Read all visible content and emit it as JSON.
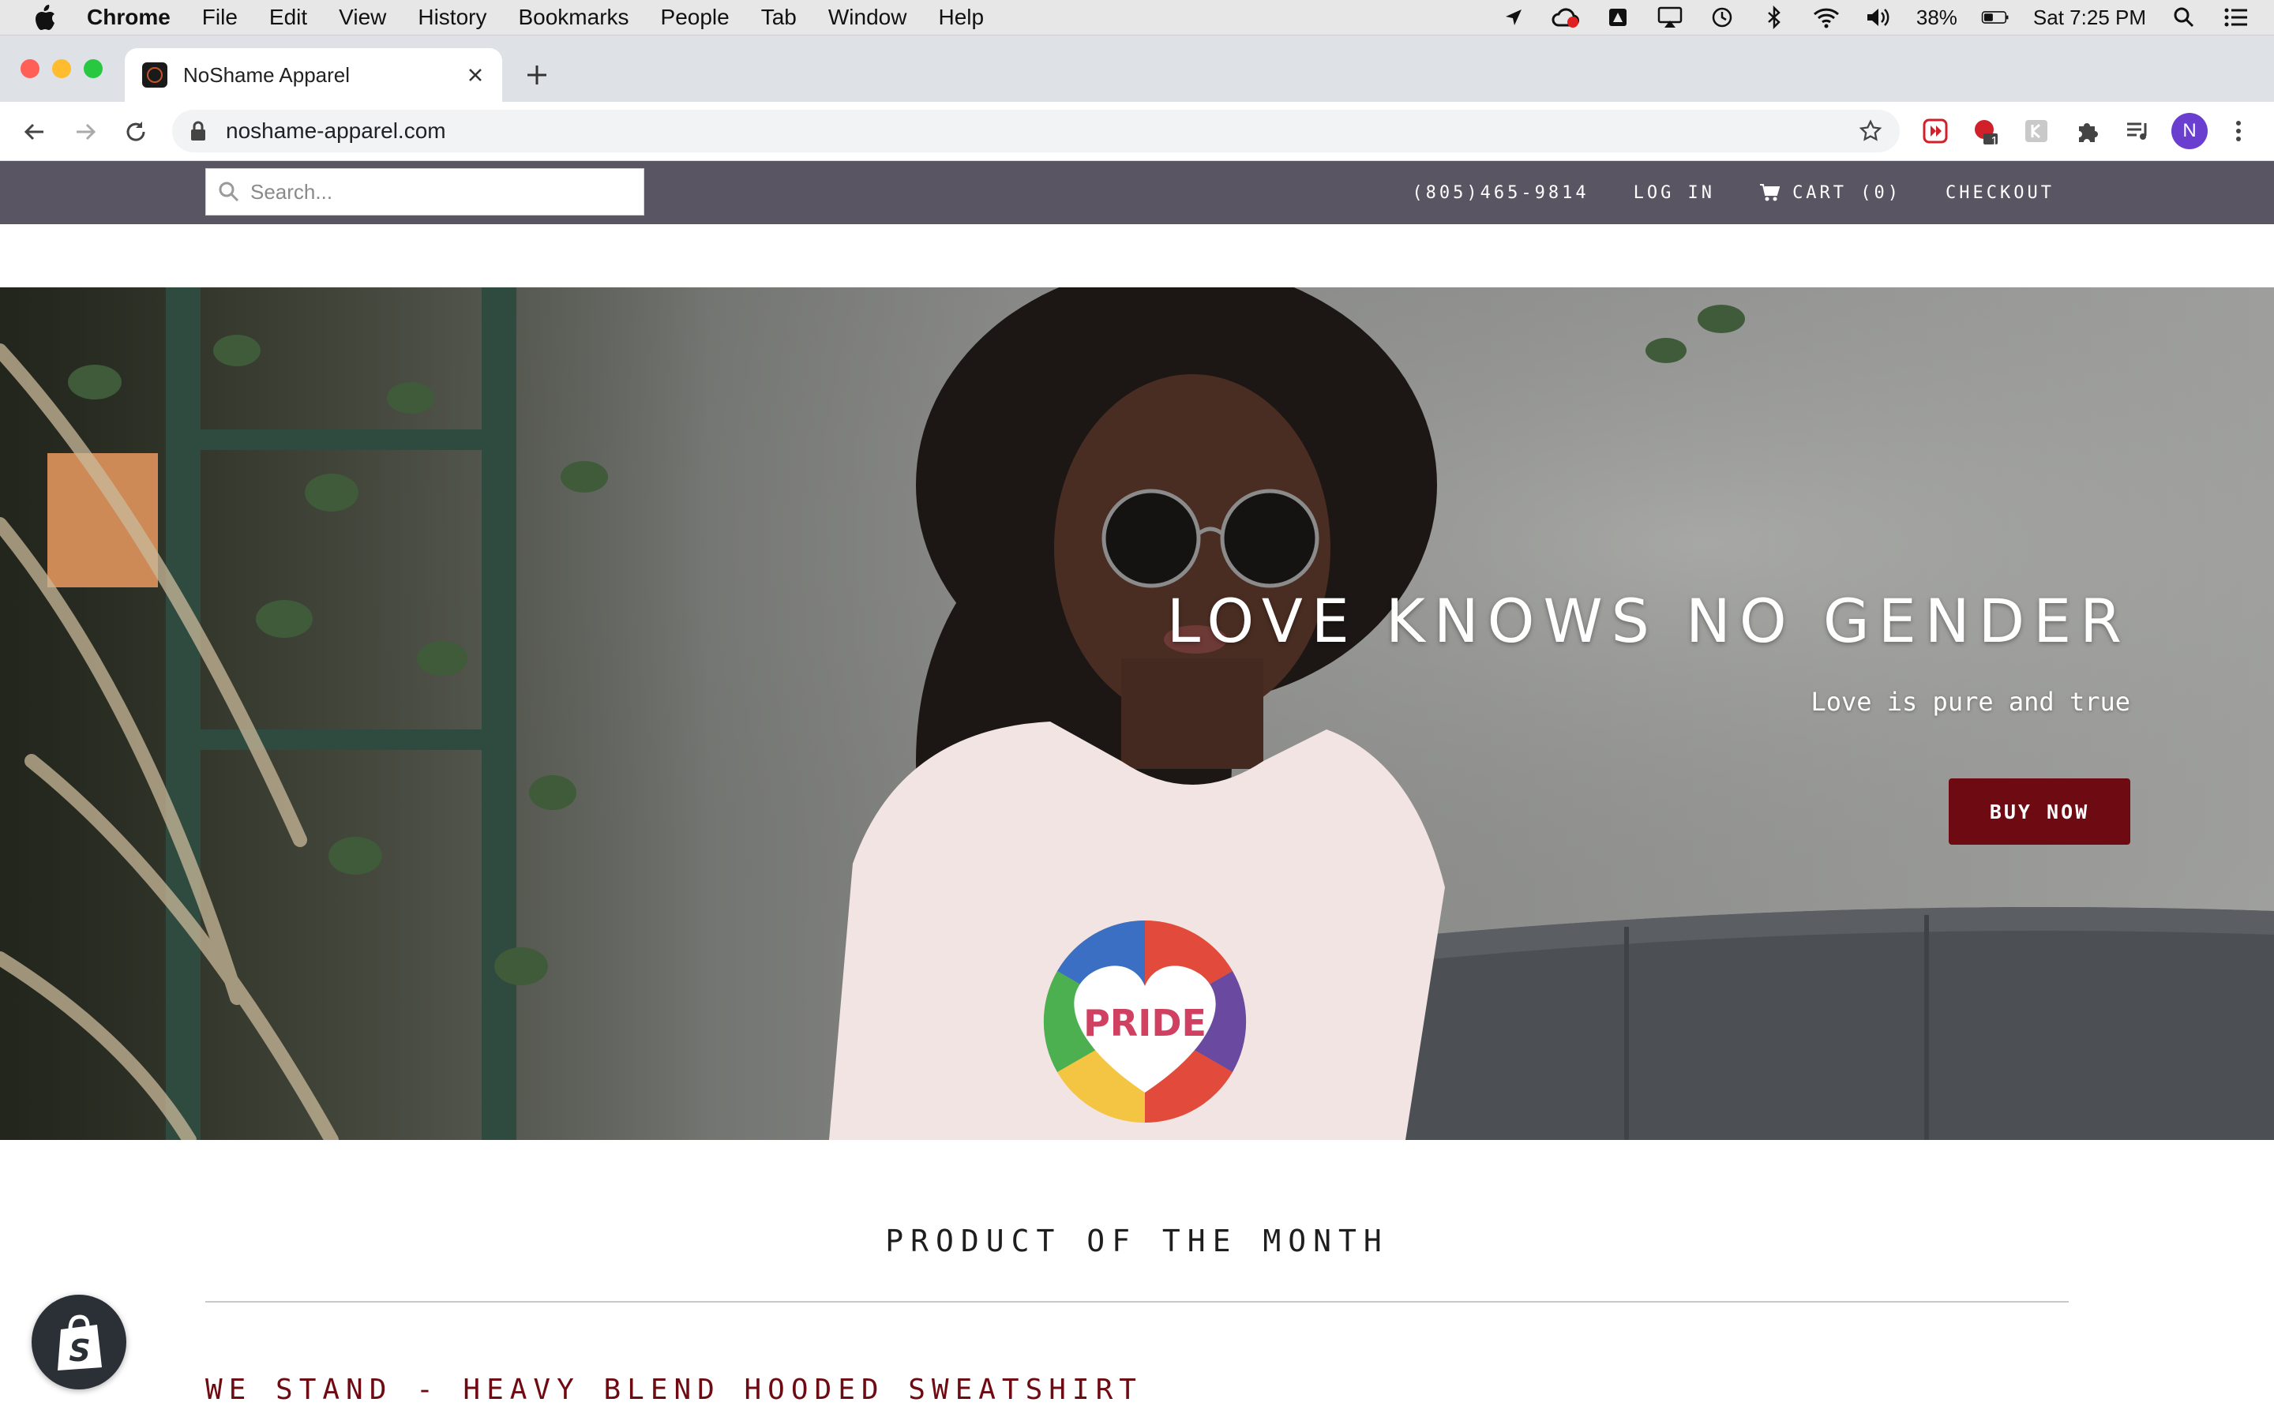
{
  "menubar": {
    "app_name": "Chrome",
    "items": [
      "File",
      "Edit",
      "View",
      "History",
      "Bookmarks",
      "People",
      "Tab",
      "Window",
      "Help"
    ],
    "battery": "38%",
    "clock": "Sat 7:25 PM"
  },
  "browser": {
    "tab_title": "NoShame Apparel",
    "url": "noshame-apparel.com",
    "extension_badge": "1",
    "profile_initial": "N"
  },
  "site": {
    "search_placeholder": "Search...",
    "phone": "(805)465-9814",
    "login": "LOG IN",
    "cart": "CART (0)",
    "checkout": "CHECKOUT"
  },
  "hero": {
    "title": "LOVE KNOWS NO GENDER",
    "subtitle": "Love is pure and true",
    "cta": "BUY NOW",
    "shirt_text": "PRIDE"
  },
  "section": {
    "title": "PRODUCT OF THE MONTH",
    "product_title": "WE STAND - HEAVY BLEND HOODED SWEATSHIRT"
  },
  "colors": {
    "header_bg": "#5a5563",
    "accent": "#6e0a12"
  }
}
